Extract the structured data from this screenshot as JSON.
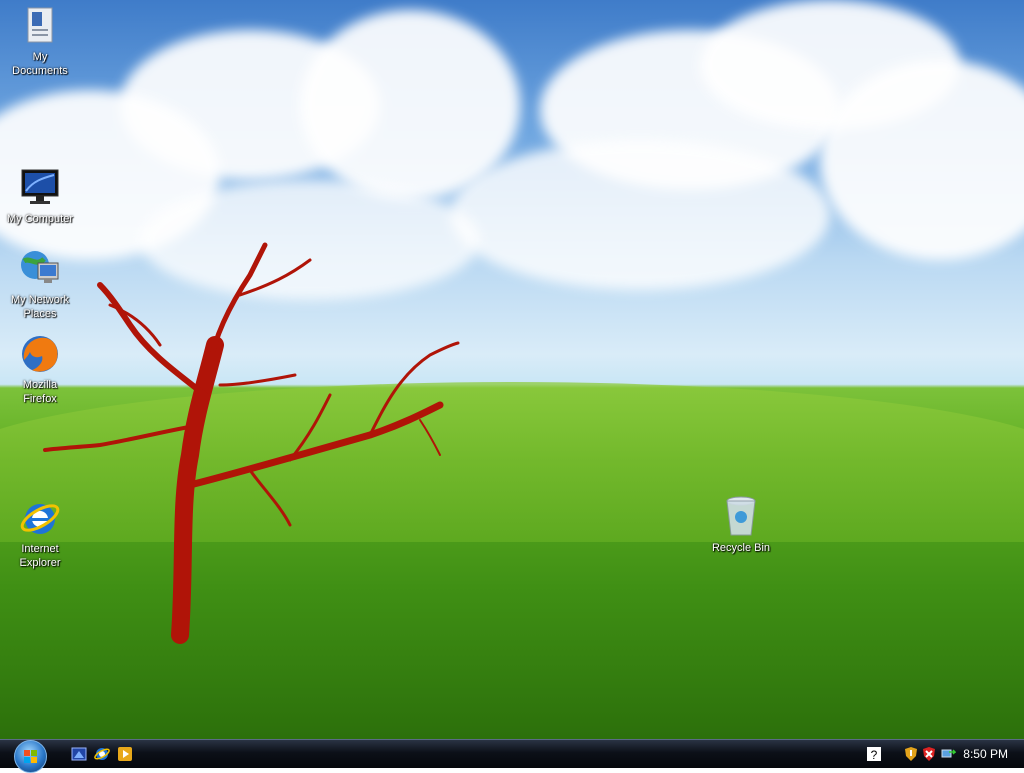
{
  "desktop": {
    "icons": [
      {
        "label": "My\nDocuments",
        "icon": "my-documents-icon"
      },
      {
        "label": "My Computer",
        "icon": "my-computer-icon"
      },
      {
        "label": "My Network\nPlaces",
        "icon": "network-places-icon"
      },
      {
        "label": "Mozilla\nFirefox",
        "icon": "firefox-icon"
      },
      {
        "label": "Internet\nExplorer",
        "icon": "internet-explorer-icon"
      },
      {
        "label": "Recycle Bin",
        "icon": "recycle-bin-icon"
      }
    ]
  },
  "taskbar": {
    "quick_launch": [
      "show-desktop-icon",
      "internet-explorer-icon",
      "media-player-icon"
    ],
    "tray": [
      "help-icon",
      "security-shield-icon",
      "security-alert-icon",
      "network-icon"
    ],
    "clock": "8:50 PM"
  }
}
